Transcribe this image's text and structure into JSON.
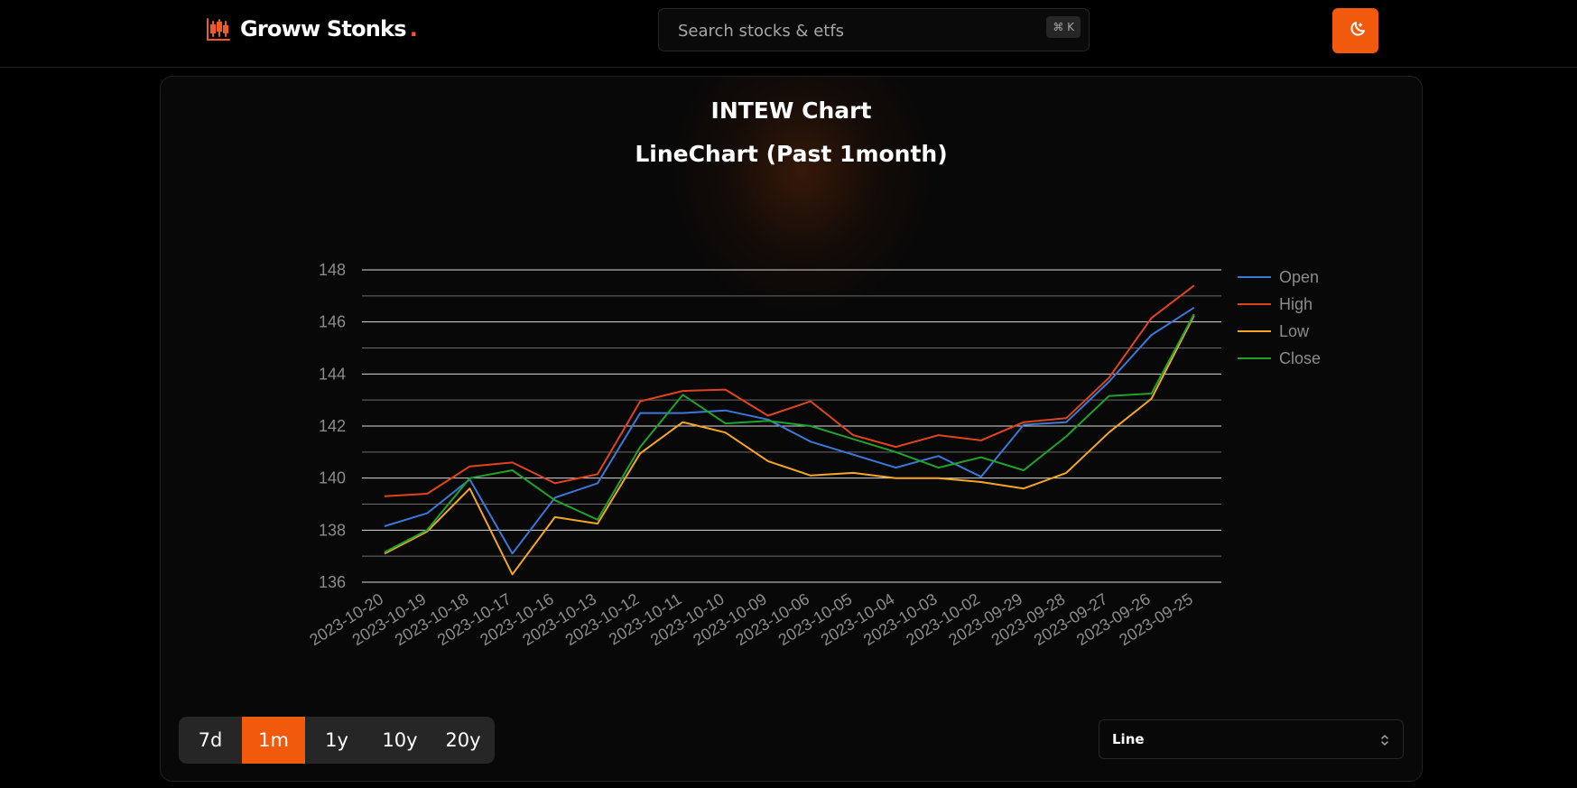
{
  "header": {
    "brand": "Groww Stonks",
    "brand_dot": ".",
    "search_placeholder": "Search stocks & etfs",
    "search_shortcut": "⌘ K",
    "theme_icon": "moon-icon",
    "accent_color": "#f15a0d"
  },
  "chart_card": {
    "title": "INTEW Chart",
    "subtitle": "LineChart (Past 1month)"
  },
  "range_tabs": [
    {
      "label": "7d",
      "active": false
    },
    {
      "label": "1m",
      "active": true
    },
    {
      "label": "1y",
      "active": false
    },
    {
      "label": "10y",
      "active": false
    },
    {
      "label": "20y",
      "active": false
    }
  ],
  "chart_type_select": {
    "value": "Line"
  },
  "chart_data": {
    "type": "line",
    "categories": [
      "2023-10-20",
      "2023-10-19",
      "2023-10-18",
      "2023-10-17",
      "2023-10-16",
      "2023-10-13",
      "2023-10-12",
      "2023-10-11",
      "2023-10-10",
      "2023-10-09",
      "2023-10-06",
      "2023-10-05",
      "2023-10-04",
      "2023-10-03",
      "2023-10-02",
      "2023-09-29",
      "2023-09-28",
      "2023-09-27",
      "2023-09-26",
      "2023-09-25"
    ],
    "ylim": [
      136,
      148
    ],
    "yticks": [
      136,
      138,
      140,
      142,
      144,
      146,
      148
    ],
    "grid": true,
    "legend": "right",
    "series": [
      {
        "name": "Open",
        "color": "#3c78d8",
        "values": [
          138.15,
          138.65,
          139.95,
          137.1,
          139.25,
          139.8,
          142.5,
          142.5,
          142.6,
          142.25,
          141.4,
          140.9,
          140.4,
          140.85,
          140.05,
          142.05,
          142.15,
          143.7,
          145.5,
          146.55
        ]
      },
      {
        "name": "High",
        "color": "#e0441c",
        "values": [
          139.3,
          139.4,
          140.45,
          140.6,
          139.8,
          140.15,
          142.95,
          143.35,
          143.4,
          142.4,
          142.95,
          141.65,
          141.2,
          141.65,
          141.45,
          142.15,
          142.3,
          143.85,
          146.15,
          147.4
        ]
      },
      {
        "name": "Low",
        "color": "#f5a623",
        "values": [
          137.1,
          137.95,
          139.6,
          136.3,
          138.5,
          138.25,
          140.95,
          142.15,
          141.75,
          140.65,
          140.1,
          140.2,
          140.0,
          140.0,
          139.85,
          139.6,
          140.2,
          141.75,
          143.05,
          146.25
        ]
      },
      {
        "name": "Close",
        "color": "#1fa32a",
        "values": [
          137.15,
          138.0,
          140.0,
          140.3,
          139.15,
          138.4,
          141.2,
          143.2,
          142.1,
          142.2,
          142.0,
          141.5,
          141.0,
          140.4,
          140.8,
          140.3,
          141.6,
          143.15,
          143.25,
          146.3
        ]
      }
    ]
  }
}
